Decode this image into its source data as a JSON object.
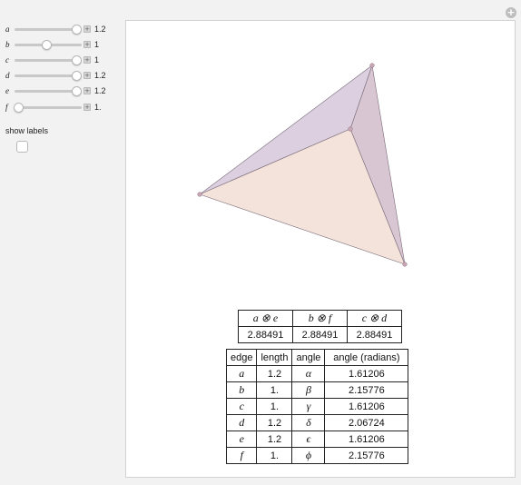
{
  "sliders": [
    {
      "name": "a",
      "value": "1.2",
      "pos": 1.0
    },
    {
      "name": "b",
      "value": "1",
      "pos": 0.5
    },
    {
      "name": "c",
      "value": "1",
      "pos": 1.0
    },
    {
      "name": "d",
      "value": "1.2",
      "pos": 1.0
    },
    {
      "name": "e",
      "value": "1.2",
      "pos": 1.0
    },
    {
      "name": "f",
      "value": "1.",
      "pos": 0.0
    }
  ],
  "show_labels": "show labels",
  "table1": {
    "headers": [
      "a ⊗ e",
      "b ⊗ f",
      "c ⊗ d"
    ],
    "values": [
      "2.88491",
      "2.88491",
      "2.88491"
    ]
  },
  "table2": {
    "headers": [
      "edge",
      "length",
      "angle",
      "angle (radians)"
    ],
    "rows": [
      [
        "a",
        "1.2",
        "α",
        "1.61206"
      ],
      [
        "b",
        "1.",
        "β",
        "2.15776"
      ],
      [
        "c",
        "1.",
        "γ",
        "1.61206"
      ],
      [
        "d",
        "1.2",
        "δ",
        "2.06724"
      ],
      [
        "e",
        "1.2",
        "ϵ",
        "1.61206"
      ],
      [
        "f",
        "1.",
        "ϕ",
        "2.15776"
      ]
    ]
  },
  "colors": {
    "face_front": "#f3e3db",
    "face_back": "#dcd0e0",
    "face_right": "#d8c6d2",
    "edge": "#7a6a78"
  }
}
